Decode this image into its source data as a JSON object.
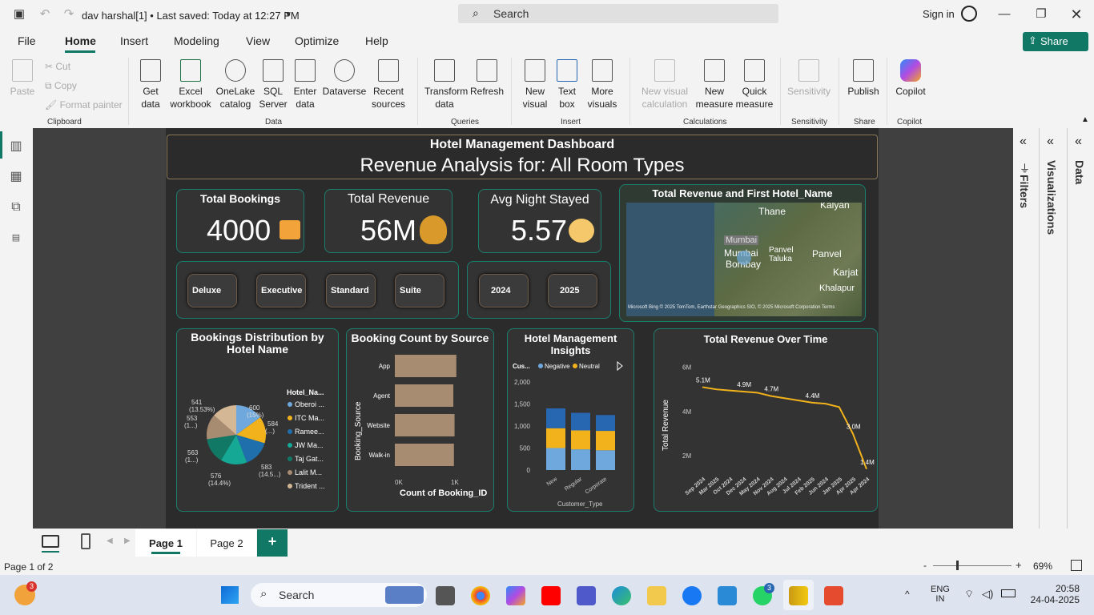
{
  "titlebar": {
    "doc_title": "dav harshal[1] • Last saved: Today at 12:27 PM",
    "search_placeholder": "Search",
    "sign_in": "Sign in"
  },
  "menu": [
    "File",
    "Home",
    "Insert",
    "Modeling",
    "View",
    "Optimize",
    "Help"
  ],
  "share": "Share",
  "ribbon": {
    "clipboard": {
      "paste": "Paste",
      "cut": "Cut",
      "copy": "Copy",
      "format_painter": "Format painter",
      "group": "Clipboard"
    },
    "data": {
      "items": [
        "Get data",
        "Excel workbook",
        "OneLake catalog",
        "SQL Server",
        "Enter data",
        "Dataverse",
        "Recent sources"
      ],
      "group": "Data"
    },
    "queries": {
      "items": [
        "Transform data",
        "Refresh"
      ],
      "group": "Queries"
    },
    "insert": {
      "items": [
        "New visual",
        "Text box",
        "More visuals"
      ],
      "group": "Insert"
    },
    "calculations": {
      "items": [
        "New visual calculation",
        "New measure",
        "Quick measure"
      ],
      "group": "Calculations"
    },
    "sensitivity": {
      "item": "Sensitivity",
      "group": "Sensitivity"
    },
    "share": {
      "item": "Publish",
      "group": "Share"
    },
    "copilot": {
      "item": "Copilot",
      "group": "Copilot"
    }
  },
  "dashboard": {
    "title": "Hotel Management Dashboard",
    "subtitle": "Revenue Analysis for: All Room Types",
    "kpis": [
      {
        "label": "Total Bookings",
        "value": "4000"
      },
      {
        "label": "Total Revenue",
        "value": "56M"
      },
      {
        "label": "Avg Night Stayed",
        "value": "5.57"
      }
    ],
    "room_slicers": [
      "Deluxe",
      "Executive",
      "Standard",
      "Suite"
    ],
    "year_slicers": [
      "2024",
      "2025"
    ],
    "map": {
      "title": "Total Revenue and First Hotel_Name",
      "labels": [
        "Kalyan",
        "Thane",
        "Mumbai",
        "Mumbai",
        "Bombay",
        "Panvel Taluka",
        "Panvel",
        "Karjat",
        "Khalapur"
      ],
      "footer": "Microsoft Bing  © 2025 TomTom, Earthstar Geographics SIO, © 2025 Microsoft Corporation  Terms"
    }
  },
  "chart_data": [
    {
      "type": "pie",
      "title": "Bookings Distribution by Hotel Name",
      "legend_title": "Hotel_Na...",
      "legend": [
        "Oberoi ...",
        "ITC Ma...",
        "Ramee...",
        "JW Ma...",
        "Taj Gat...",
        "Lalit M...",
        "Trident ..."
      ],
      "values": [
        600,
        584,
        583,
        576,
        563,
        553,
        541
      ],
      "data_labels": [
        "600 (15%)",
        "584 (...)",
        "583 (14.5...)",
        "576 (14.4%)",
        "563 (1...)",
        "553 (1...)",
        "541 (13.53%)"
      ],
      "colors": [
        "#6ea8dc",
        "#f2b21b",
        "#1f6fad",
        "#15a894",
        "#117865",
        "#a88c72",
        "#d4b896"
      ]
    },
    {
      "type": "bar",
      "title": "Booking Count by Source",
      "categories": [
        "App",
        "Agent",
        "Website",
        "Walk-in"
      ],
      "values": [
        1030,
        980,
        1000,
        990
      ],
      "xlabel": "Count of Booking_ID",
      "ylabel": "Booking_Source",
      "xticks": [
        "0K",
        "1K"
      ],
      "xlim": [
        0,
        1100
      ]
    },
    {
      "type": "bar",
      "title": "Hotel Management Insights",
      "categories": [
        "New",
        "Regular",
        "Corporate"
      ],
      "legend_title": "Cus...",
      "series": [
        {
          "name": "Negative",
          "values": [
            500,
            470,
            450
          ]
        },
        {
          "name": "Neutral",
          "values": [
            450,
            430,
            440
          ]
        },
        {
          "name": "",
          "values": [
            450,
            400,
            360
          ]
        }
      ],
      "yticks": [
        "0",
        "500",
        "1,000",
        "1,500",
        "2,000"
      ],
      "xlabel": "Customer_Type",
      "ylim": [
        0,
        2000
      ]
    },
    {
      "type": "line",
      "title": "Total Revenue Over Time",
      "ylabel": "Total Revenue",
      "yticks": [
        "2M",
        "4M",
        "6M"
      ],
      "ylim": [
        1.5,
        6.2
      ],
      "x": [
        "Sep 2024",
        "Mar 2025",
        "Oct 2024",
        "Dec 2024",
        "May 2024",
        "Nov 2024",
        "Aug 2024",
        "Jul 2024",
        "Feb 2025",
        "Jun 2024",
        "Jan 2025",
        "Apr 2025",
        "Apr 2024"
      ],
      "values": [
        5.1,
        5.0,
        4.95,
        4.9,
        4.85,
        4.7,
        4.6,
        4.5,
        4.4,
        4.35,
        4.2,
        3.0,
        1.4
      ],
      "data_labels": [
        "5.1M",
        "4.9M",
        "4.7M",
        "4.4M",
        "3.0M",
        "1.4M"
      ]
    }
  ],
  "tabs": {
    "page1": "Page 1",
    "page2": "Page 2",
    "add": "+"
  },
  "status": {
    "page_info": "Page 1 of 2",
    "zoom": "69%"
  },
  "taskbar": {
    "search": "Search",
    "lang1": "ENG",
    "lang2": "IN",
    "time": "20:58",
    "date": "24-04-2025",
    "badge_weather": "3",
    "badge_whatsapp": "3"
  }
}
